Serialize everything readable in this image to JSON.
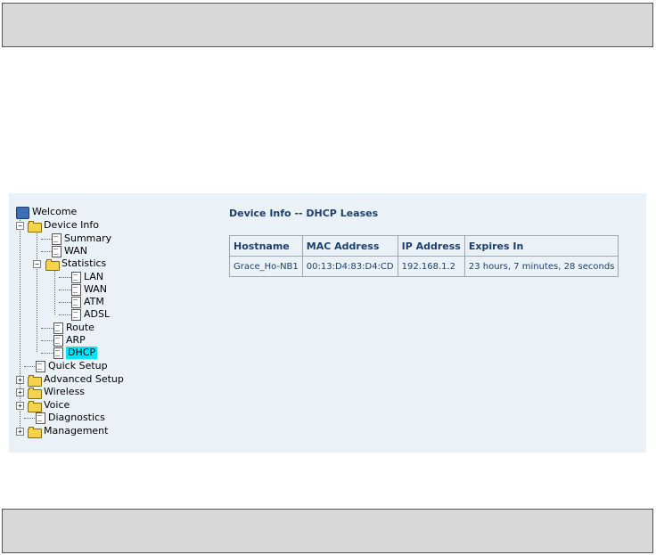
{
  "tree": {
    "welcome": "Welcome",
    "device_info": "Device Info",
    "summary": "Summary",
    "wan": "WAN",
    "statistics": "Statistics",
    "stats_lan": "LAN",
    "stats_wan": "WAN",
    "stats_atm": "ATM",
    "stats_adsl": "ADSL",
    "route": "Route",
    "arp": "ARP",
    "dhcp": "DHCP",
    "quick_setup": "Quick Setup",
    "advanced_setup": "Advanced Setup",
    "wireless": "Wireless",
    "voice": "Voice",
    "diagnostics": "Diagnostics",
    "management": "Management",
    "selected": "DHCP"
  },
  "page": {
    "title": "Device Info -- DHCP Leases"
  },
  "table": {
    "headers": [
      "Hostname",
      "MAC Address",
      "IP Address",
      "Expires In"
    ],
    "rows": [
      [
        "Grace_Ho-NB1",
        "00:13:D4:83:D4:CD",
        "192.168.1.2",
        "23 hours, 7 minutes, 28 seconds"
      ]
    ]
  },
  "colors": {
    "panel_bg": "#eaf2f8",
    "title_color": "#1c3f6b",
    "selected_bg": "#00e5ff",
    "bar_bg": "#d9d9d9"
  }
}
